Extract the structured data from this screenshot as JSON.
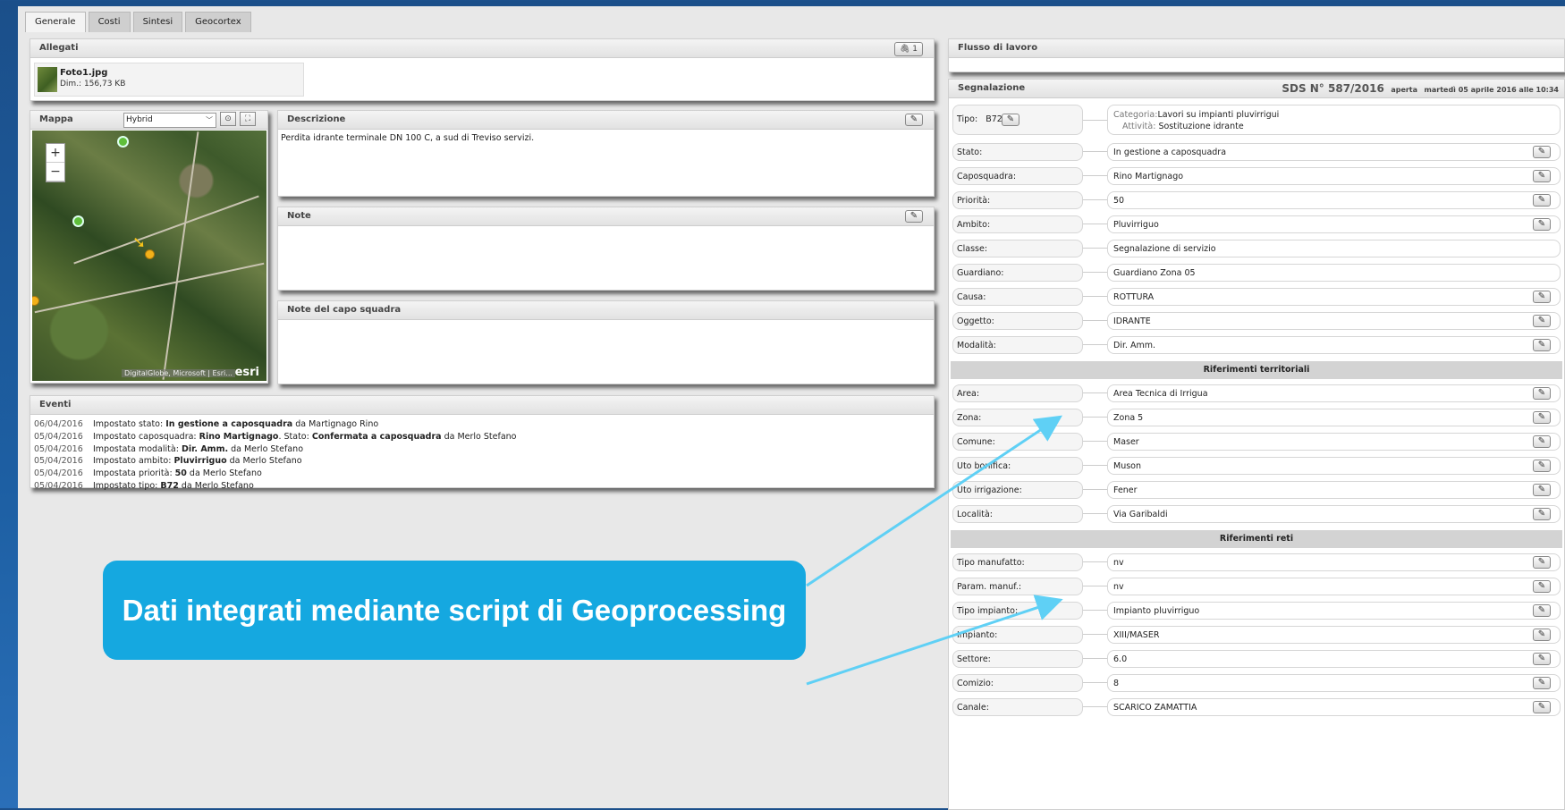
{
  "tabs": [
    "Generale",
    "Costi",
    "Sintesi",
    "Geocortex"
  ],
  "allegati": {
    "title": "Allegati",
    "count": "1",
    "file_name": "Foto1.jpg",
    "file_size": "Dim.: 156,73 KB"
  },
  "mappa": {
    "title": "Mappa",
    "basemap": "Hybrid",
    "zoom_in": "+",
    "zoom_out": "−",
    "attribution": "DigitalGlobe, Microsoft | Esri...",
    "logo": "esri"
  },
  "descrizione": {
    "title": "Descrizione",
    "text": "Perdita idrante terminale DN 100 C, a sud di Treviso servizi."
  },
  "note": {
    "title": "Note"
  },
  "note_capo": {
    "title": "Note del capo squadra"
  },
  "eventi": {
    "title": "Eventi",
    "rows": [
      {
        "date": "06/04/2016",
        "pre": "Impostato stato: ",
        "bold": "In gestione a caposquadra",
        "post": " da Martignago Rino"
      },
      {
        "date": "05/04/2016",
        "pre": "Impostato caposquadra: ",
        "bold": "Rino Martignago",
        "mid": ". Stato: ",
        "bold2": "Confermata a caposquadra",
        "post": " da Merlo Stefano"
      },
      {
        "date": "05/04/2016",
        "pre": "Impostata modalità: ",
        "bold": "Dir. Amm.",
        "post": " da Merlo Stefano"
      },
      {
        "date": "05/04/2016",
        "pre": "Impostato ambito: ",
        "bold": "Pluvirriguo",
        "post": " da Merlo Stefano"
      },
      {
        "date": "05/04/2016",
        "pre": "Impostata priorità: ",
        "bold": "50",
        "post": " da Merlo Stefano"
      },
      {
        "date": "05/04/2016",
        "pre": "Impostato tipo: ",
        "bold": "B72",
        "post": " da Merlo Stefano"
      }
    ]
  },
  "flusso": {
    "title": "Flusso di lavoro"
  },
  "segnalazione": {
    "title": "Segnalazione",
    "sds": "SDS N° 587/2016",
    "status": "aperta",
    "date": "martedì 05 aprile 2016 alle 10:34",
    "tipo_label": "Tipo:",
    "tipo_value": "B72",
    "categoria_label": "Categoria:",
    "categoria_value": "Lavori su impianti pluvirrigui",
    "attivita_label": "Attività:",
    "attivita_value": "Sostituzione idrante",
    "fields": [
      {
        "label": "Stato:",
        "value": "In gestione a caposquadra",
        "edit": true
      },
      {
        "label": "Caposquadra:",
        "value": "Rino Martignago",
        "edit": true
      },
      {
        "label": "Priorità:",
        "value": "50",
        "edit": true
      },
      {
        "label": "Ambito:",
        "value": "Pluvirriguo",
        "edit": true
      },
      {
        "label": "Classe:",
        "value": "Segnalazione di servizio",
        "edit": false
      },
      {
        "label": "Guardiano:",
        "value": "Guardiano Zona 05",
        "edit": false
      },
      {
        "label": "Causa:",
        "value": "ROTTURA",
        "edit": true
      },
      {
        "label": "Oggetto:",
        "value": "IDRANTE",
        "edit": true
      },
      {
        "label": "Modalità:",
        "value": "Dir. Amm.",
        "edit": true
      }
    ],
    "rif_territoriali": {
      "title": "Riferimenti territoriali",
      "fields": [
        {
          "label": "Area:",
          "value": "Area Tecnica di Irrigua"
        },
        {
          "label": "Zona:",
          "value": "Zona 5"
        },
        {
          "label": "Comune:",
          "value": "Maser"
        },
        {
          "label": "Uto bonifica:",
          "value": "Muson"
        },
        {
          "label": "Uto irrigazione:",
          "value": "Fener"
        },
        {
          "label": "Località:",
          "value": "Via Garibaldi"
        }
      ]
    },
    "rif_reti": {
      "title": "Riferimenti reti",
      "fields": [
        {
          "label": "Tipo manufatto:",
          "value": "nv"
        },
        {
          "label": "Param. manuf.:",
          "value": "nv"
        },
        {
          "label": "Tipo impianto:",
          "value": "Impianto pluvirriguo"
        },
        {
          "label": "Impianto:",
          "value": "XIII/MASER"
        },
        {
          "label": "Settore:",
          "value": "6.0"
        },
        {
          "label": "Comizio:",
          "value": "8"
        },
        {
          "label": "Canale:",
          "value": "SCARICO ZAMATTIA"
        }
      ]
    }
  },
  "callout": {
    "text": "Dati integrati mediante script di Geoprocessing",
    "color": "#15a8e0"
  }
}
